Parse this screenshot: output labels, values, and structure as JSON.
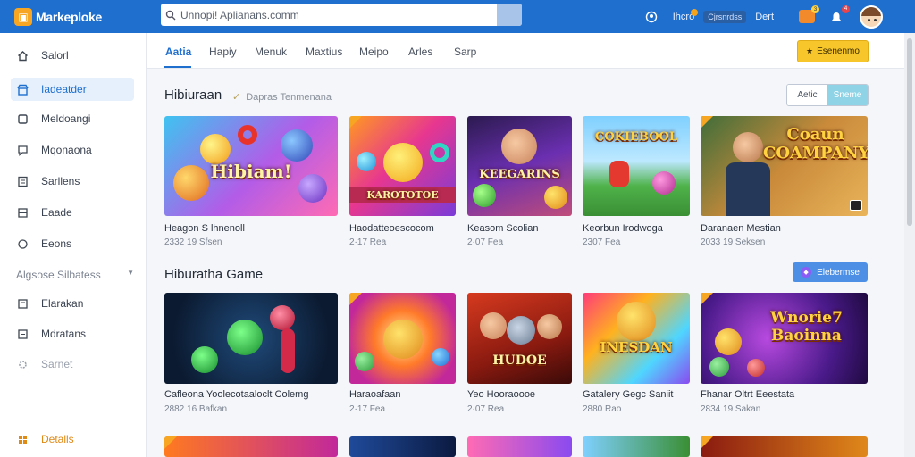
{
  "app": {
    "name": "Markeploke",
    "logo_glyph": "▣"
  },
  "search": {
    "value": "Unnopi! Aplianans.comm",
    "icon": "search-icon"
  },
  "header": {
    "user_label": "Ihcro",
    "user_pill": "Cjrsnrdss",
    "link": "Dert",
    "cart_count": "3",
    "bell_count": "4"
  },
  "sidebar": {
    "items": [
      {
        "label": "Salorl",
        "icon": "home-icon"
      },
      {
        "label": "Iadeatder",
        "icon": "store-icon"
      },
      {
        "label": "Meldoangi",
        "icon": "box-icon"
      },
      {
        "label": "Mqonaona",
        "icon": "chat-icon"
      },
      {
        "label": "Sarllens",
        "icon": "list-icon"
      },
      {
        "label": "Eaade",
        "icon": "grid-icon"
      },
      {
        "label": "Eeons",
        "icon": "settings-icon"
      }
    ],
    "section_label": "Algsose Silbatess",
    "items2": [
      {
        "label": "Elarakan",
        "icon": "folder-icon"
      },
      {
        "label": "Mdratans",
        "icon": "doc-icon"
      },
      {
        "label": "Sarnet",
        "icon": "gear-icon"
      }
    ],
    "footer": {
      "label": "Detalls",
      "icon": "grid-icon"
    }
  },
  "tabs": [
    "Aatia",
    "Hapiy",
    "Menuk",
    "Maxtius",
    "Meipo",
    "Arles",
    "Sarp"
  ],
  "cta": {
    "label": "Esenenmo",
    "icon": "star-icon"
  },
  "section1": {
    "title": "Hibiuraan",
    "subtitle": "Dapras Tenmenana",
    "segment": [
      "Aetic",
      "Sneme"
    ],
    "cards": [
      {
        "title": "Heagon S lhnenoll",
        "meta": "2332 19 Sfsen",
        "art_text": "Hibiam!"
      },
      {
        "title": "Haodatteoescocom",
        "meta": "2·17 Rea",
        "art_text": "KAROTOTOE"
      },
      {
        "title": "Keasom Scolian",
        "meta": "2·07 Fea",
        "art_text": "KEEGARINS"
      },
      {
        "title": "Keorbun Irodwoga",
        "meta": "2307 Fea",
        "art_text": "COKIEBOOL"
      },
      {
        "title": "Daranaen Mestian",
        "meta": "2033 19 Seksen",
        "art_text": "Coaun COAMPANY"
      }
    ]
  },
  "section2": {
    "title": "Hiburatha Game",
    "button": "Elebermse",
    "cards": [
      {
        "title": "Cafleona Yoolecotaaloclt Colemg",
        "meta": "2882 16 Bafkan",
        "art_text": ""
      },
      {
        "title": "Haraoafaan",
        "meta": "2·17 Fea",
        "art_text": ""
      },
      {
        "title": "Yeo Hooraoooe",
        "meta": "2·07 Rea",
        "art_text": "HUDOE"
      },
      {
        "title": "Gatalery Gegc Saniit",
        "meta": "2880 Rao",
        "art_text": "INESDAN"
      },
      {
        "title": "Fhanar Oltrt Eeestata",
        "meta": "2834 19 Sakan",
        "art_text": "Wnorie7 Baoinna"
      }
    ]
  },
  "colors": {
    "accent": "#1f6fcf",
    "cta": "#f7c62a"
  }
}
